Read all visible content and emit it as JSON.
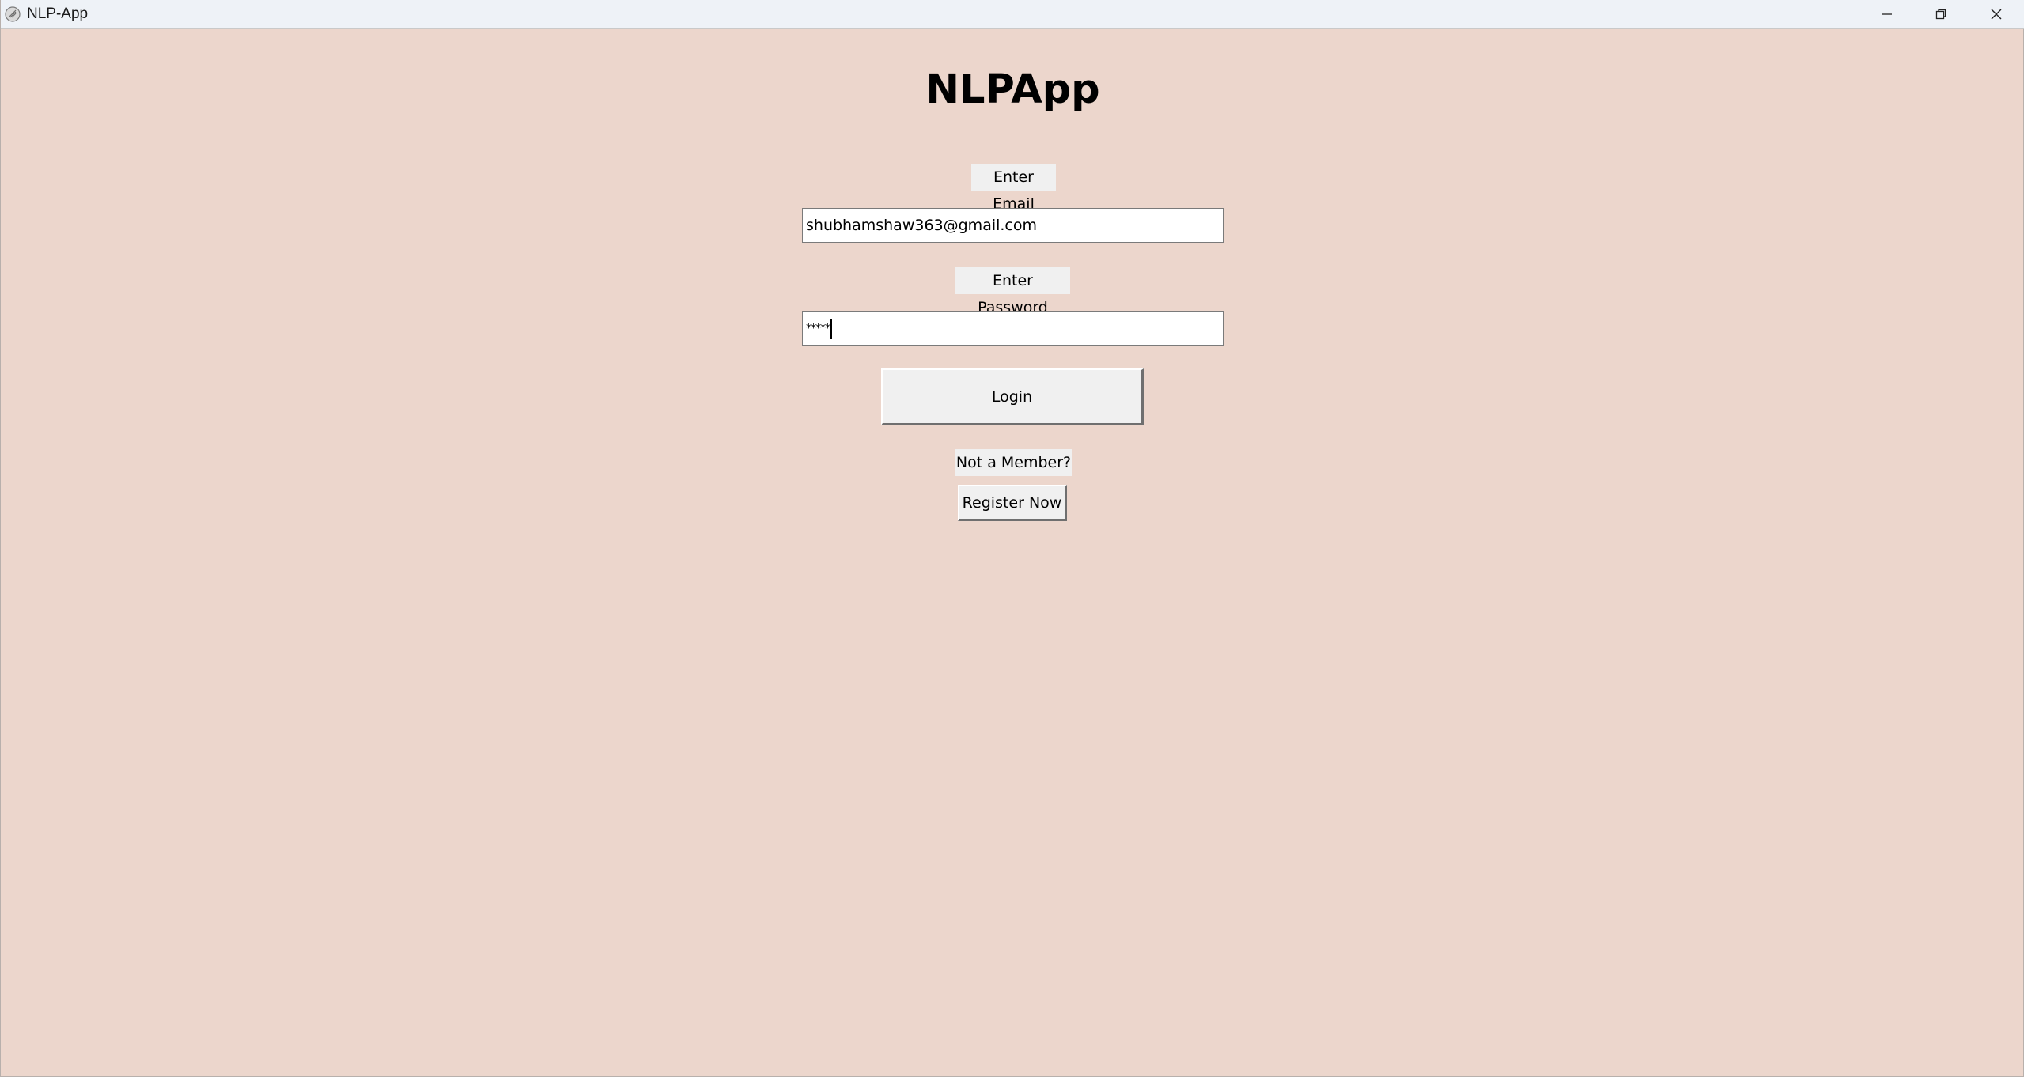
{
  "window": {
    "title": "NLP-App",
    "app_icon": "feather-icon",
    "controls": {
      "minimize_icon": "minimize-icon",
      "maximize_icon": "restore-icon",
      "close_icon": "close-icon"
    }
  },
  "page": {
    "heading": "NLPApp",
    "background_color": "#ecd6cc"
  },
  "form": {
    "email_label": "Enter Email",
    "email_value": "shubhamshaw363@gmail.com",
    "password_label": "Enter Password",
    "password_value_masked": "*****",
    "login_label": "Login",
    "not_member_label": "Not a Member?",
    "register_label": "Register Now"
  }
}
